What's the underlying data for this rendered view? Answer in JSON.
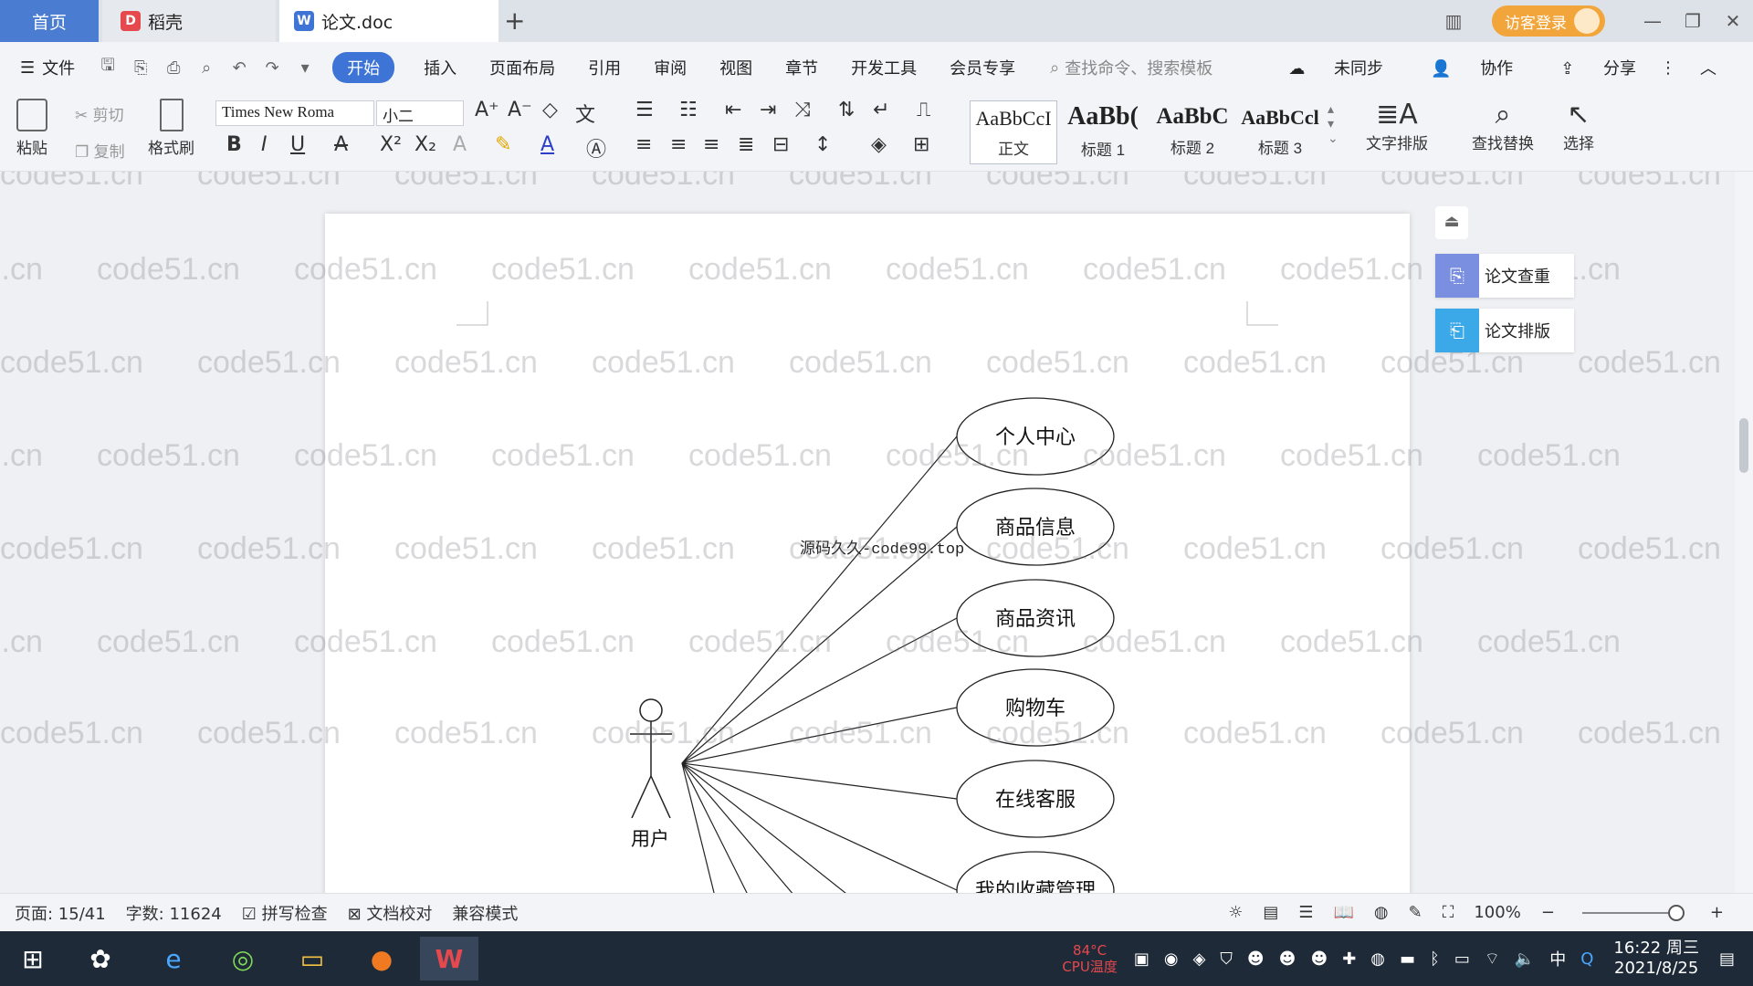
{
  "tabs": {
    "home": "首页",
    "daoke": "稻壳",
    "doc": "论文.doc",
    "add": "+"
  },
  "titlebar": {
    "login": "访客登录"
  },
  "menu": {
    "file": "文件",
    "items": [
      "开始",
      "插入",
      "页面布局",
      "引用",
      "审阅",
      "视图",
      "章节",
      "开发工具",
      "会员专享"
    ],
    "search_placeholder": "查找命令、搜索模板",
    "sync": "未同步",
    "collab": "协作",
    "share": "分享"
  },
  "ribbon": {
    "paste": "粘贴",
    "cut": "剪切",
    "copy": "复制",
    "format_painter": "格式刷",
    "font_name": "Times New Roma",
    "font_size": "小二",
    "styles": [
      {
        "sample": "AaBbCcI",
        "name": "正文"
      },
      {
        "sample": "AaBb(",
        "name": "标题 1"
      },
      {
        "sample": "AaBbC",
        "name": "标题 2"
      },
      {
        "sample": "AaBbCcl",
        "name": "标题 3"
      }
    ],
    "text_layout": "文字排版",
    "find_replace": "查找替换",
    "select": "选择"
  },
  "side_panel": {
    "check": "论文查重",
    "layout": "论文排版"
  },
  "document": {
    "watermark": "code51.cn",
    "source_label": "源码久久-code99.top",
    "actor": "用户",
    "use_cases": [
      "个人中心",
      "商品信息",
      "商品资讯",
      "购物车",
      "在线客服",
      "我的收藏管理"
    ]
  },
  "status": {
    "page": "页面: 15/41",
    "words": "字数: 11624",
    "spell": "拼写检查",
    "proof": "文档校对",
    "compat": "兼容模式",
    "zoom": "100%"
  },
  "taskbar": {
    "cpu_temp": "84°C",
    "cpu_label": "CPU温度",
    "time": "16:22 周三",
    "date": "2021/8/25",
    "ime": "中"
  },
  "colors": {
    "accent": "#3e74d6",
    "login": "#f1a53a",
    "check_icon": "#7b8fe0",
    "layout_icon": "#3ba8e8"
  }
}
